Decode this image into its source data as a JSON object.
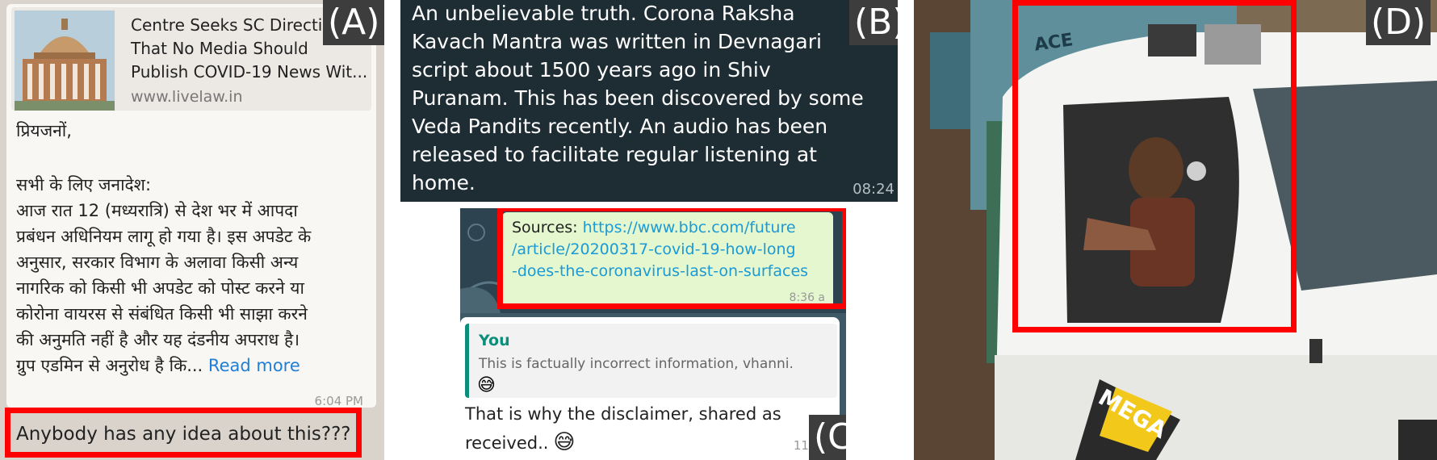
{
  "panel_a": {
    "tag": "(A)",
    "link_title_lines": [
      "Centre Seeks SC Direction",
      "That No Media Should",
      "Publish COVID-19 News Wit..."
    ],
    "link_site": "www.livelaw.in",
    "message_lines": [
      "प्रियजनों,",
      "सभी के लिए जनादेश:",
      " आज रात 12 (मध्यरात्रि) से देश भर में आपदा",
      "प्रबंधन अधिनियम लागू हो गया है। इस अपडेट के",
      "अनुसार, सरकार विभाग के अलावा किसी अन्य",
      "नागरिक को किसी भी अपडेट को पोस्ट करने या",
      "कोरोना वायरस से संबंधित किसी भी साझा करने",
      "की अनुमति नहीं है और यह दंडनीय अपराध है।",
      "ग्रुप एडमिन से अनुरोध है कि..."
    ],
    "read_more": "Read more",
    "time": "6:04 PM",
    "question": "Anybody has any idea about this???"
  },
  "panel_b": {
    "tag": "(B)",
    "lines": [
      "An unbelievable truth. Corona Raksha",
      "Kavach Mantra was written in Devnagari",
      "script  about 1500 years ago in Shiv",
      "Puranam. This has been discovered by some",
      "Veda Pandits recently. An audio has been",
      "released to facilitate regular listening at",
      "home."
    ],
    "time": "08:24"
  },
  "panel_c": {
    "tag": "(C)",
    "sources_label": "Sources:",
    "url_lines": [
      "https://www.bbc.com/future",
      "/article/20200317-covid-19-how-long",
      "-does-the-coronavirus-last-on-surfaces"
    ],
    "sources_time": "8:36 a",
    "quote_author": "You",
    "quote_text": "This is factually incorrect information, vhanni.",
    "quote_emoji": "😅",
    "reply_lines": [
      "That is why the disclaimer, shared as",
      "received.."
    ],
    "reply_emoji": "😅",
    "reply_time": "11:14 a"
  },
  "panel_d": {
    "tag": "(D)",
    "truck_text_1": "MEGA",
    "banner_text": "ACE"
  },
  "colors": {
    "highlight_red": "#ff0000",
    "whatsapp_dark_bubble": "#1e2c33",
    "whatsapp_green_bubble": "#e4f7ce",
    "link_blue": "#1b9ad6",
    "quote_teal": "#0c8e7b"
  }
}
